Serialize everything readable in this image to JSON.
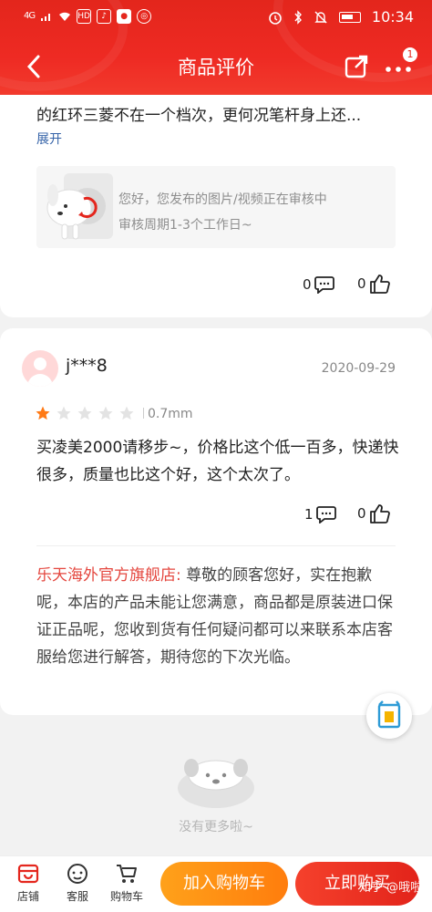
{
  "colors": {
    "brand_red": "#e4261d",
    "cart_orange": "#ff8c14",
    "shop_name": "#e4463e",
    "link_blue": "#3563a8"
  },
  "status_bar": {
    "signal": "4G",
    "hd": "HD",
    "time": "10:34"
  },
  "nav": {
    "title": "商品评价",
    "badge": "1",
    "back_icon": "chevron-left-icon",
    "share_icon": "share-icon",
    "more_icon": "more-icon"
  },
  "review1": {
    "text_truncated": "的红环三菱不在一个档次，更何况笔杆身上还...",
    "expand_label": "展开",
    "notice_line1": "您好，您发布的图片/视频正在审核中",
    "notice_line2": "审核周期1-3个工作日~",
    "comment_count": "0",
    "like_count": "0"
  },
  "review2": {
    "username": "j***8",
    "date": "2020-09-29",
    "rating": 1,
    "rating_max": 5,
    "spec": "0.7mm",
    "content": "买凌美2000请移步~，价格比这个低一百多，快递快很多，质量也比这个好，这个太次了。",
    "comment_count": "1",
    "like_count": "0",
    "reply_shop": "乐天海外官方旗舰店:",
    "reply_text": " 尊敬的顾客您好，实在抱歉呢，本店的产品未能让您满意，商品都是原装进口保证正品呢，您收到货有任何疑问都可以来联系本店客服给您进行解答，期待您的下次光临。"
  },
  "end": {
    "text": "没有更多啦~"
  },
  "bottom": {
    "store": "店铺",
    "service": "客服",
    "cart": "购物车",
    "add_to_cart": "加入购物车",
    "buy_now": "立即购买"
  },
  "watermark": "知乎 @哦啦"
}
